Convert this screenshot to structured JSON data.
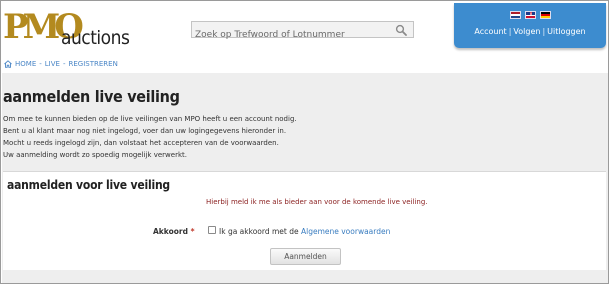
{
  "header": {
    "logo_mark": "PMO",
    "logo_text": "auctions",
    "search_placeholder": "Zoek op Trefwoord of Lotnummer",
    "account_links": [
      "Account",
      "Volgen",
      "Uitloggen"
    ],
    "account_separator": "|",
    "languages": [
      "nl",
      "en",
      "de"
    ]
  },
  "breadcrumb": [
    "HOME",
    "LIVE",
    "REGISTREREN"
  ],
  "breadcrumb_separator": "-",
  "page": {
    "title": "aanmelden live veiling",
    "intro": [
      "Om mee te kunnen bieden op de live veilingen van MPO heeft u een account nodig.",
      "Bent u al klant maar nog niet ingelogd, voer dan uw logingegevens hieronder in.",
      "Mocht u reeds ingelogd zijn, dan volstaat het accepteren van de voorwaarden.",
      "Uw aanmelding wordt zo spoedig mogelijk verwerkt."
    ]
  },
  "form": {
    "panel_title": "aanmelden voor live veiling",
    "note": "Hierbij meld ik me als bieder aan voor de komende live veiling.",
    "agree_label": "Akkoord",
    "required_marker": "*",
    "agree_text": "Ik ga akkoord met de",
    "terms_link": "Algemene voorwaarden",
    "agree_checked": false,
    "submit_label": "Aanmelden"
  },
  "colors": {
    "accent_blue": "#3d8ccf",
    "link_blue": "#4a86c6",
    "note_red": "#8a1f1f",
    "logo_gold": "#b38a1f"
  }
}
